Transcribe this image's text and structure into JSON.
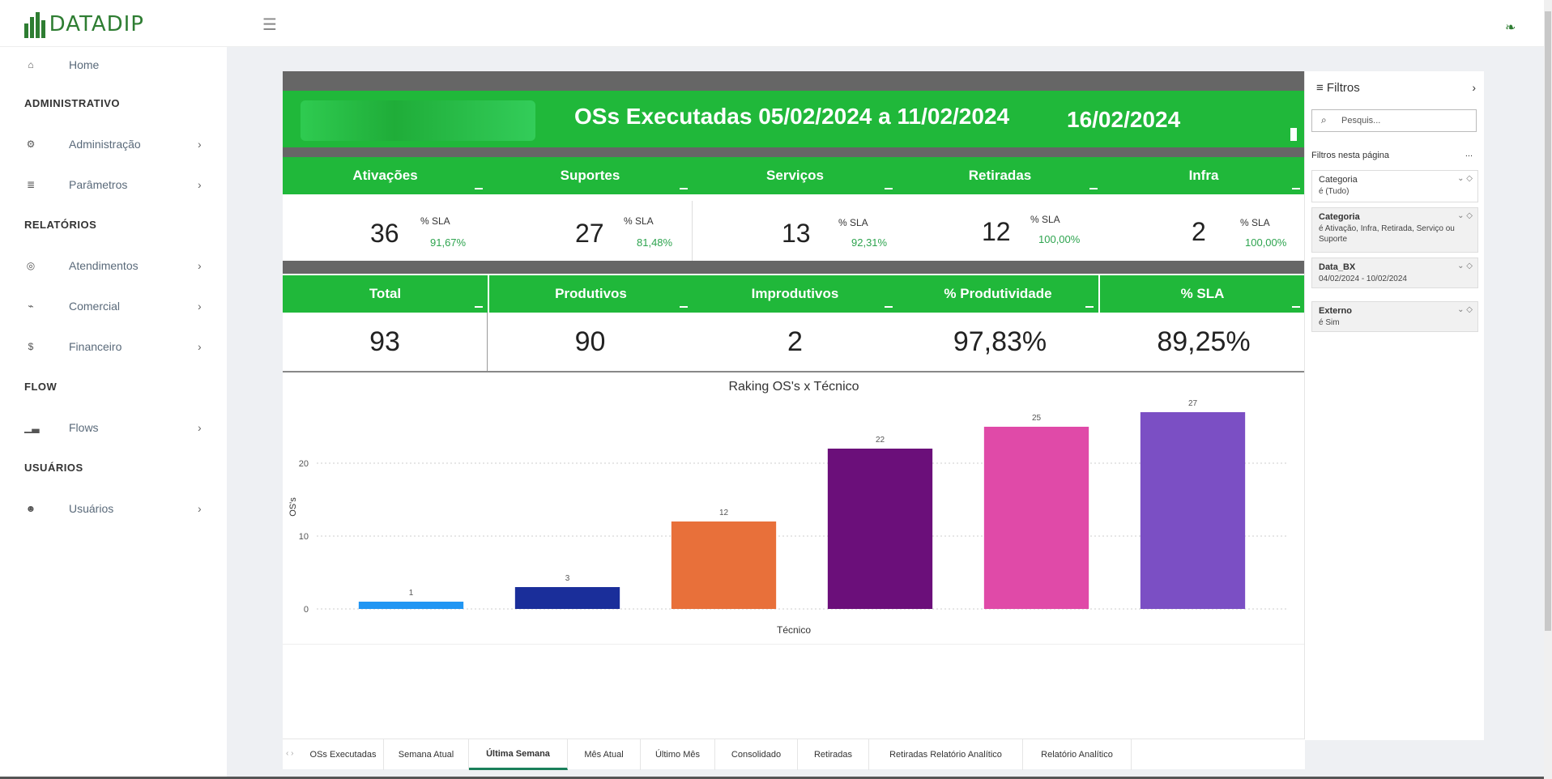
{
  "app": {
    "logo_text": "DATADIP"
  },
  "sidebar": {
    "home": "Home",
    "sections": [
      "ADMINISTRATIVO",
      "RELATÓRIOS",
      "FLOW",
      "USUÁRIOS"
    ],
    "items": [
      {
        "label": "Administração",
        "icon": "cogs-icon"
      },
      {
        "label": "Parâmetros",
        "icon": "list-icon"
      },
      {
        "label": "Atendimentos",
        "icon": "headset-icon"
      },
      {
        "label": "Comercial",
        "icon": "chart-line-icon"
      },
      {
        "label": "Financeiro",
        "icon": "dollar-icon"
      },
      {
        "label": "Flows",
        "icon": "bar-chart-icon"
      },
      {
        "label": "Usuários",
        "icon": "users-icon"
      }
    ]
  },
  "banner": {
    "title": "OSs Executadas 05/02/2024 a 11/02/2024",
    "date": "16/02/2024"
  },
  "kpis": [
    {
      "label": "Ativações",
      "value": "36",
      "sla_label": "% SLA",
      "sla": "91,67%"
    },
    {
      "label": "Suportes",
      "value": "27",
      "sla_label": "% SLA",
      "sla": "81,48%"
    },
    {
      "label": "Serviços",
      "value": "13",
      "sla_label": "% SLA",
      "sla": "92,31%"
    },
    {
      "label": "Retiradas",
      "value": "12",
      "sla_label": "% SLA",
      "sla": "100,00%"
    },
    {
      "label": "Infra",
      "value": "2",
      "sla_label": "% SLA",
      "sla": "100,00%"
    }
  ],
  "totals": [
    {
      "label": "Total",
      "value": "93"
    },
    {
      "label": "Produtivos",
      "value": "90"
    },
    {
      "label": "Improdutivos",
      "value": "2"
    },
    {
      "label": "% Produtividade",
      "value": "97,83%"
    },
    {
      "label": "% SLA",
      "value": "89,25%"
    }
  ],
  "chart_data": {
    "type": "bar",
    "title": "Raking OS's x Técnico",
    "xlabel": "Técnico",
    "ylabel": "OS's",
    "categories": [
      "",
      "",
      "",
      "",
      "",
      ""
    ],
    "values": [
      1,
      3,
      12,
      22,
      25,
      27
    ],
    "colors": [
      "#2196f3",
      "#1a2e9a",
      "#e8703a",
      "#6b0f7a",
      "#e04aa8",
      "#7b4fc4"
    ],
    "ylim": [
      0,
      28
    ],
    "yticks": [
      0,
      10,
      20
    ],
    "grid": true
  },
  "filters": {
    "title": "Filtros",
    "search_placeholder": "Pesquis...",
    "page_label": "Filtros nesta página",
    "page_dots": "...",
    "cards": [
      {
        "name": "Categoria",
        "desc": "é (Tudo)",
        "active": false
      },
      {
        "name": "Categoria",
        "desc": "é Ativação, Infra, Retirada, Serviço ou Suporte",
        "active": true
      },
      {
        "name": "Data_BX",
        "desc": "04/02/2024 - 10/02/2024",
        "active": true
      },
      {
        "name": "Externo",
        "desc": "é Sim",
        "active": true
      }
    ]
  },
  "tabs": [
    {
      "label": "OSs Executadas",
      "active": false
    },
    {
      "label": "Semana Atual",
      "active": false
    },
    {
      "label": "Última Semana",
      "active": true
    },
    {
      "label": "Mês Atual",
      "active": false
    },
    {
      "label": "Último Mês",
      "active": false
    },
    {
      "label": "Consolidado",
      "active": false
    },
    {
      "label": "Retiradas",
      "active": false
    },
    {
      "label": "Retiradas Relatório Analítico",
      "active": false
    },
    {
      "label": "Relatório Analítico",
      "active": false
    }
  ]
}
